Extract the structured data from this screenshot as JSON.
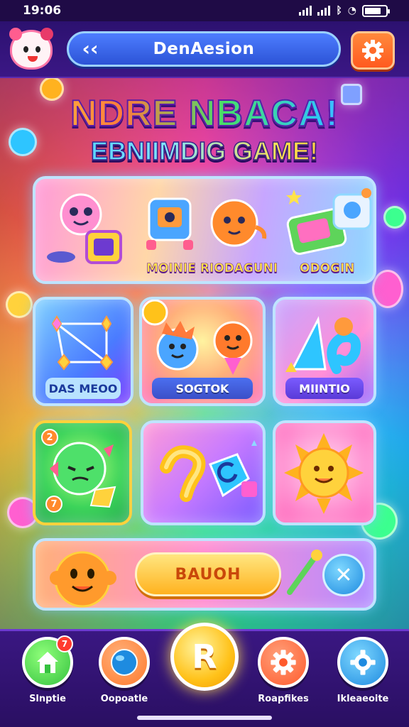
{
  "status_bar": {
    "time": "19:06"
  },
  "header": {
    "title": "DenAesion",
    "back_icon": "chevron-left-icon",
    "settings_icon": "gear-icon"
  },
  "headline": {
    "line1": "NDRE NBACA!",
    "line2": "EBNIIMDIG GAME!"
  },
  "featured": {
    "label_left": "MOINIE RIODAGUNI",
    "label_right": "ODOGIN"
  },
  "tiles_row1": [
    {
      "label": "DAS MEOO",
      "label_color": "#2a7de0"
    },
    {
      "label": "SOGTOK",
      "label_color": "#3b6fd8"
    },
    {
      "label": "MIINTIO",
      "label_color": "#5a4de0"
    }
  ],
  "tiles_row2": [
    {
      "badge": "2",
      "bottom_badge": "7"
    },
    {
      "glyph": "?"
    },
    {
      "icon": "sun-icon"
    }
  ],
  "playbar": {
    "button_label": "BAUOH",
    "close_icon": "close-icon"
  },
  "nav": {
    "items": [
      {
        "label": "Slnptie",
        "icon": "house-icon",
        "badge": "7",
        "color": "#35c23f"
      },
      {
        "label": "Oopoatle",
        "icon": "globe-icon",
        "color": "#ff7a2c"
      },
      {
        "label": "Roapfikes",
        "icon": "gear-icon",
        "color": "#ff5a2c"
      },
      {
        "label": "Ikleaeoite",
        "icon": "gear-icon",
        "color": "#1e8be0"
      }
    ],
    "center_glyph": "R"
  },
  "colors": {
    "accent_orange": "#ff5a1f",
    "accent_blue": "#2c53d6",
    "nav_bg": "#2a0f62"
  }
}
